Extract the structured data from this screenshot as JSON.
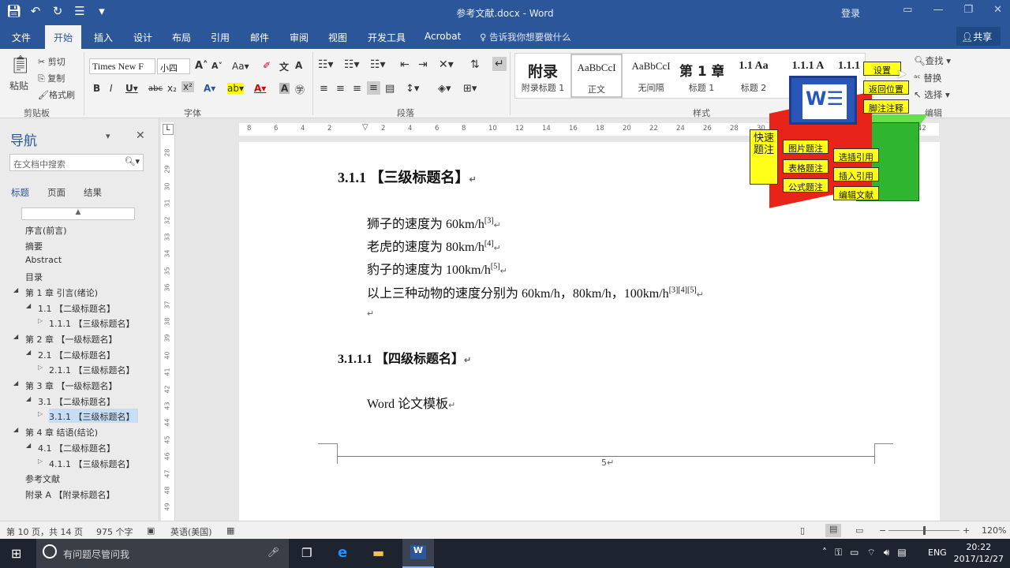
{
  "titlebar": {
    "title": "参考文献.docx  -  Word",
    "login": "登录",
    "qat_icons": [
      "save-icon",
      "undo-icon",
      "redo-icon",
      "paragraph-icon",
      "customize-icon"
    ]
  },
  "tabs": {
    "items": [
      "文件",
      "开始",
      "插入",
      "设计",
      "布局",
      "引用",
      "邮件",
      "审阅",
      "视图",
      "开发工具",
      "Acrobat"
    ],
    "active": "开始",
    "tellme": "告诉我你想要做什么",
    "share": "共享"
  },
  "ribbon": {
    "clipboard": {
      "paste": "粘贴",
      "cut": "剪切",
      "copy": "复制",
      "format_painter": "格式刷",
      "label": "剪贴板"
    },
    "font": {
      "name": "Times New F",
      "size": "小四",
      "label": "字体"
    },
    "paragraph": {
      "label": "段落"
    },
    "styles": {
      "label": "样式",
      "items": [
        {
          "preview": "附录",
          "name": "附录标题 1"
        },
        {
          "preview": "AaBbCcI",
          "name": "正文"
        },
        {
          "preview": "AaBbCcI",
          "name": "无间隔"
        },
        {
          "preview": "第 1 章",
          "name": "标题 1"
        },
        {
          "preview": "1.1  Aa",
          "name": "标题 2"
        },
        {
          "preview": "1.1.1  A",
          "name": ""
        },
        {
          "preview": "1.1.1",
          "name": ""
        }
      ]
    },
    "editing": {
      "find": "查找",
      "replace": "替换",
      "select": "选择",
      "label": "编辑"
    }
  },
  "nav": {
    "title": "导航",
    "search_placeholder": "在文档中搜索",
    "tabs": [
      "标题",
      "页面",
      "结果"
    ],
    "items": [
      {
        "text": "序言(前言)",
        "level": 1
      },
      {
        "text": "摘要",
        "level": 1
      },
      {
        "text": "Abstract",
        "level": 1
      },
      {
        "text": "目录",
        "level": 1
      },
      {
        "text": "第 1 章 引言(绪论)",
        "level": 1
      },
      {
        "text": "1.1 【二级标题名】",
        "level": 2
      },
      {
        "text": "1.1.1 【三级标题名】",
        "level": 3
      },
      {
        "text": "第 2 章 【一级标题名】",
        "level": 1
      },
      {
        "text": "2.1 【二级标题名】",
        "level": 2
      },
      {
        "text": "2.1.1 【三级标题名】",
        "level": 3
      },
      {
        "text": "第 3 章 【一级标题名】",
        "level": 1
      },
      {
        "text": "3.1 【二级标题名】",
        "level": 2
      },
      {
        "text": "3.1.1 【三级标题名】",
        "level": 3
      },
      {
        "text": "第 4 章 结语(结论)",
        "level": 1
      },
      {
        "text": "4.1 【二级标题名】",
        "level": 2
      },
      {
        "text": "4.1.1 【三级标题名】",
        "level": 3
      },
      {
        "text": "参考文献",
        "level": 1
      },
      {
        "text": "附录 A 【附录标题名】",
        "level": 1
      }
    ]
  },
  "document": {
    "heading3": "3.1.1  【三级标题名】",
    "lines": [
      {
        "text": "狮子的速度为 60km/h",
        "sup": "[3]"
      },
      {
        "text": "老虎的速度为 80km/h",
        "sup": "[4]"
      },
      {
        "text": "豹子的速度为 100km/h",
        "sup": "[5]"
      },
      {
        "text": "以上三种动物的速度分别为 60km/h，80km/h，100km/h",
        "sup": "[3][4][5]"
      }
    ],
    "heading4": "3.1.1.1 【四级标题名】",
    "body2": "Word 论文模板",
    "page_number": "5"
  },
  "overlay": {
    "vertical": "快速题注",
    "labels": [
      "设置",
      "返回位置",
      "脚注注释",
      "图片题注",
      "表格题注",
      "公式题注",
      "选插引用",
      "插入引用",
      "编辑文献"
    ]
  },
  "status": {
    "page": "第 10 页，共 14 页",
    "words": "975 个字",
    "lang": "英语(美国)",
    "zoom": "120%"
  },
  "taskbar": {
    "cortana": "有问题尽管问我",
    "lang": "ENG",
    "time": "20:22",
    "date": "2017/12/27"
  }
}
